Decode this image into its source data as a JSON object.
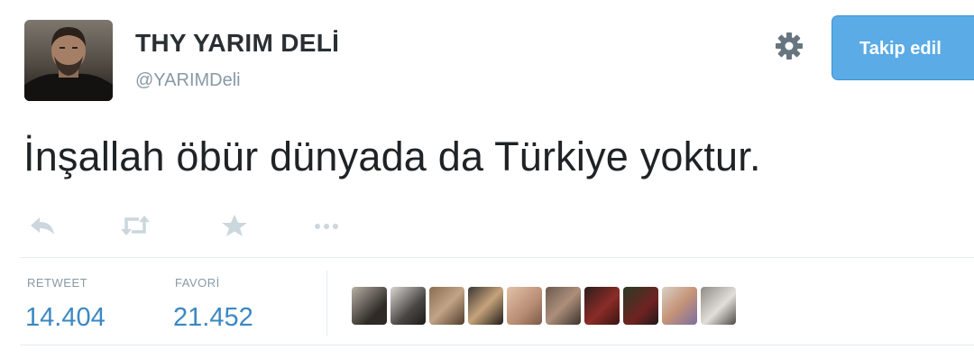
{
  "tweet": {
    "display_name": "THY YARIM DELİ",
    "screen_name": "@YARIMDeli",
    "follow_label": "Takip edil",
    "text": "İnşallah öbür dünyada da Türkiye yoktur.",
    "actions": [
      "reply-icon",
      "retweet-icon",
      "favorite-icon",
      "more-icon"
    ],
    "stats": {
      "retweet_label": "RETWEET",
      "retweet_count": "14.404",
      "favorite_label": "FAVORİ",
      "favorite_count": "21.452"
    },
    "favoriter_count": 10
  },
  "colors": {
    "follow_button": "#5aabe6",
    "stat_value": "#3b88c3",
    "muted": "#8899a6"
  }
}
